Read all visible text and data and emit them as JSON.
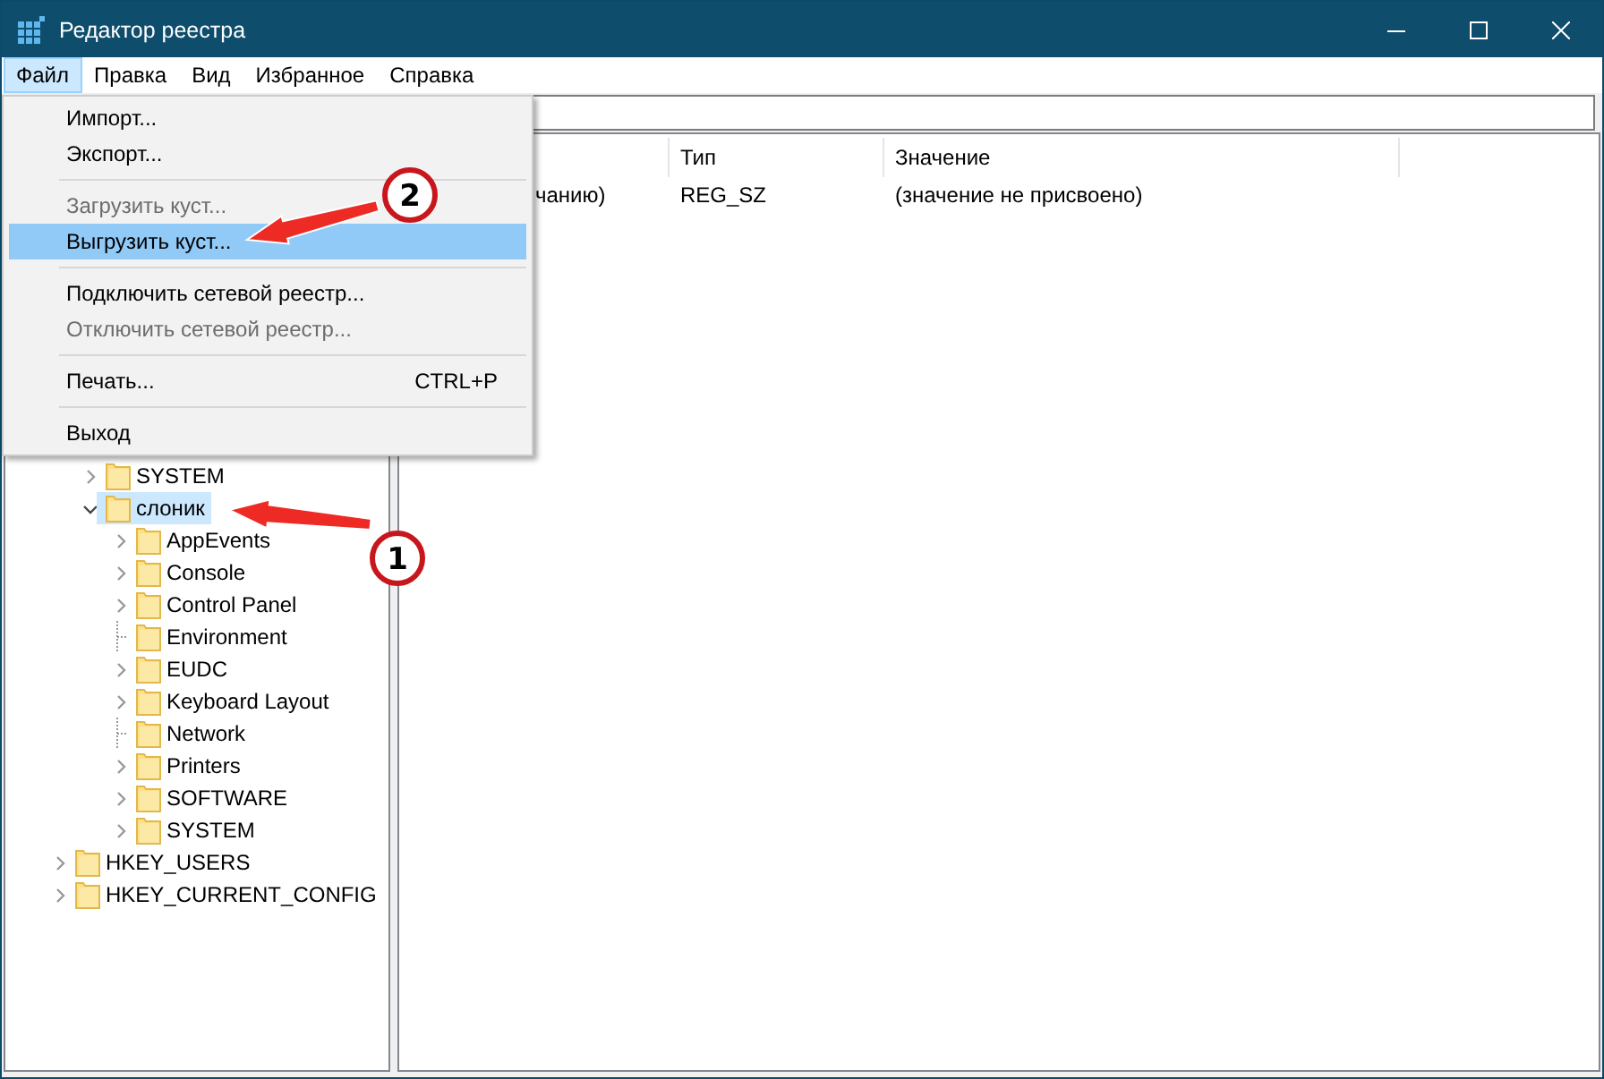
{
  "window": {
    "title": "Редактор реестра"
  },
  "menu_bar": [
    {
      "label": "Файл",
      "selected": true
    },
    {
      "label": "Правка",
      "selected": false
    },
    {
      "label": "Вид",
      "selected": false
    },
    {
      "label": "Избранное",
      "selected": false
    },
    {
      "label": "Справка",
      "selected": false
    }
  ],
  "file_menu": [
    {
      "kind": "item",
      "label": "Импорт...",
      "disabled": false,
      "selected": false
    },
    {
      "kind": "item",
      "label": "Экспорт...",
      "disabled": false,
      "selected": false
    },
    {
      "kind": "separator"
    },
    {
      "kind": "item",
      "label": "Загрузить куст...",
      "disabled": true,
      "selected": false
    },
    {
      "kind": "item",
      "label": "Выгрузить куст...",
      "disabled": false,
      "selected": true
    },
    {
      "kind": "separator"
    },
    {
      "kind": "item",
      "label": "Подключить сетевой реестр...",
      "disabled": false,
      "selected": false
    },
    {
      "kind": "item",
      "label": "Отключить сетевой реестр...",
      "disabled": true,
      "selected": false
    },
    {
      "kind": "separator"
    },
    {
      "kind": "item",
      "label": "Печать...",
      "shortcut": "CTRL+P",
      "disabled": false,
      "selected": false
    },
    {
      "kind": "separator"
    },
    {
      "kind": "item",
      "label": "Выход",
      "disabled": false,
      "selected": false
    }
  ],
  "tree": {
    "partial_branch": [
      {
        "label": "SYSTEM",
        "expandable": true,
        "expanded": false,
        "selected": false
      },
      {
        "label": "слоник",
        "expandable": true,
        "expanded": true,
        "selected": true,
        "children": [
          {
            "label": "AppEvents",
            "expandable": true,
            "expanded": false,
            "selected": false
          },
          {
            "label": "Console",
            "expandable": true,
            "expanded": false,
            "selected": false
          },
          {
            "label": "Control Panel",
            "expandable": true,
            "expanded": false,
            "selected": false
          },
          {
            "label": "Environment",
            "expandable": false,
            "expanded": false,
            "selected": false
          },
          {
            "label": "EUDC",
            "expandable": true,
            "expanded": false,
            "selected": false
          },
          {
            "label": "Keyboard Layout",
            "expandable": true,
            "expanded": false,
            "selected": false
          },
          {
            "label": "Network",
            "expandable": false,
            "expanded": false,
            "selected": false
          },
          {
            "label": "Printers",
            "expandable": true,
            "expanded": false,
            "selected": false
          },
          {
            "label": "SOFTWARE",
            "expandable": true,
            "expanded": false,
            "selected": false
          },
          {
            "label": "SYSTEM",
            "expandable": true,
            "expanded": false,
            "selected": false
          }
        ]
      }
    ],
    "roots": [
      {
        "label": "HKEY_USERS",
        "expandable": true,
        "expanded": false,
        "selected": false
      },
      {
        "label": "HKEY_CURRENT_CONFIG",
        "expandable": true,
        "expanded": false,
        "selected": false
      }
    ]
  },
  "values_table": {
    "columns": [
      "",
      "Тип",
      "Значение"
    ],
    "rows": [
      [
        "чанию)",
        "REG_SZ",
        "(значение не присвоено)"
      ]
    ]
  },
  "annotations": [
    {
      "number": "1"
    },
    {
      "number": "2"
    }
  ]
}
